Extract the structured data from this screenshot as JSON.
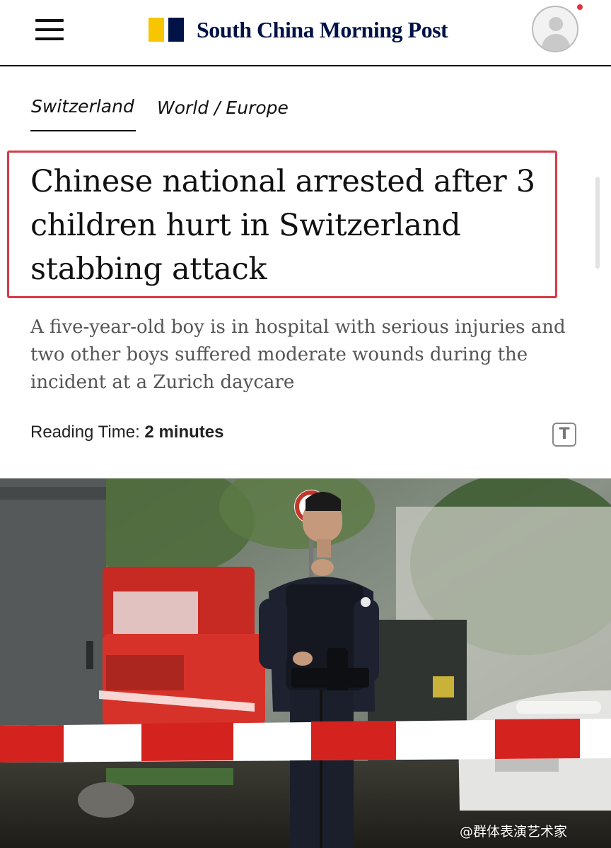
{
  "header": {
    "brand_name": "South China Morning Post",
    "menu_icon": "hamburger-menu-icon",
    "account_icon": "user-avatar-icon",
    "brand_colors": {
      "yellow": "#f7c600",
      "navy": "#001246"
    }
  },
  "article": {
    "section_primary": "Switzerland",
    "section_secondary": "World / Europe",
    "headline": "Chinese national arrested after 3 children hurt in Switzerland stabbing attack",
    "subtitle": "A five-year-old boy is in hospital with serious injuries and two other boys suffered moderate wounds during the incident at a Zurich daycare",
    "reading_time_label": "Reading Time:",
    "reading_time_value": "2 minutes",
    "font_size_button": "T",
    "highlight_color": "#d73a49"
  },
  "watermark": "@群体表演艺术家"
}
